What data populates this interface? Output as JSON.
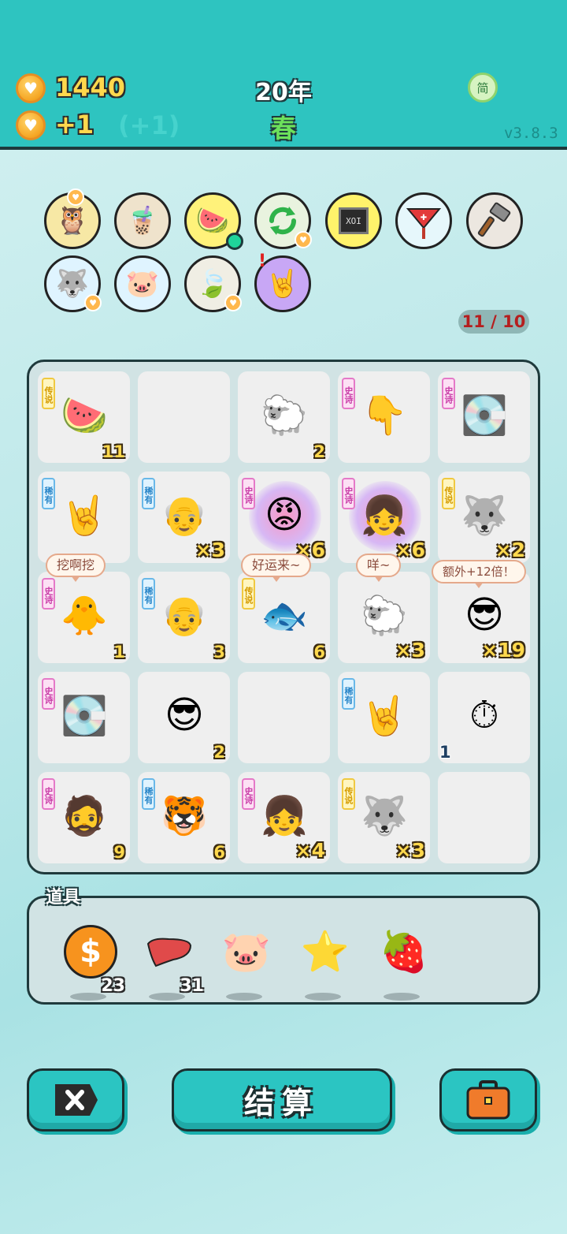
{
  "header": {
    "coins": "1440",
    "income": "+1",
    "bonus": "(+1)",
    "year": "20年",
    "season": "春",
    "lang_button": "简",
    "version": "v3.8.3"
  },
  "toolbar_icons": [
    "owls-icon",
    "bubble-tea-icon",
    "fruit-basket-icon",
    "refresh-icon",
    "chip-icon",
    "heart-potion-icon",
    "hammer-icon",
    "husky-icon",
    "piggy-bank-icon",
    "leaf-icon",
    "rock-hand-icon"
  ],
  "capacity": "11 / 10",
  "board": {
    "cells": [
      {
        "tag": "传说",
        "rarity": "legend",
        "icon": "watermelon-icon",
        "count": "11"
      },
      {
        "tag": "",
        "rarity": "",
        "icon": "",
        "count": ""
      },
      {
        "tag": "",
        "rarity": "",
        "icon": "sheep-icon",
        "count": "2"
      },
      {
        "tag": "史诗",
        "rarity": "epic",
        "icon": "pointing-hand-icon",
        "count": ""
      },
      {
        "tag": "史诗",
        "rarity": "epic",
        "icon": "graphics-card-icon",
        "count": ""
      },
      {
        "tag": "稀有",
        "rarity": "rare",
        "icon": "rock-hand-icon",
        "count": ""
      },
      {
        "tag": "稀有",
        "rarity": "rare",
        "icon": "bald-man-icon",
        "count": "×3"
      },
      {
        "tag": "史诗",
        "rarity": "epic",
        "icon": "red-face-icon",
        "count": "×6"
      },
      {
        "tag": "史诗",
        "rarity": "epic",
        "icon": "girl-icon",
        "count": "×6"
      },
      {
        "tag": "传说",
        "rarity": "legend",
        "icon": "husky-king-icon",
        "count": "×2"
      },
      {
        "tag": "史诗",
        "rarity": "epic",
        "icon": "chick-face-icon",
        "count": "1"
      },
      {
        "tag": "稀有",
        "rarity": "rare",
        "icon": "bald-man-icon",
        "count": "3"
      },
      {
        "tag": "传说",
        "rarity": "legend",
        "icon": "koi-fish-icon",
        "count": "6"
      },
      {
        "tag": "",
        "rarity": "",
        "icon": "sheep-icon",
        "count": "×3"
      },
      {
        "tag": "",
        "rarity": "",
        "icon": "sunglasses-grandpa-icon",
        "count": "×19"
      },
      {
        "tag": "史诗",
        "rarity": "epic",
        "icon": "graphics-card-icon",
        "count": ""
      },
      {
        "tag": "",
        "rarity": "",
        "icon": "sunglasses-grandpa-icon",
        "count": "2"
      },
      {
        "tag": "",
        "rarity": "",
        "icon": "",
        "count": ""
      },
      {
        "tag": "稀有",
        "rarity": "rare",
        "icon": "rock-hand-icon",
        "count": ""
      },
      {
        "tag": "",
        "rarity": "",
        "icon": "stopwatch-icon",
        "count": "1"
      },
      {
        "tag": "史诗",
        "rarity": "epic",
        "icon": "green-hat-man-icon",
        "count": "9"
      },
      {
        "tag": "稀有",
        "rarity": "rare",
        "icon": "tiger-icon",
        "count": "6"
      },
      {
        "tag": "史诗",
        "rarity": "epic",
        "icon": "girl-icon",
        "count": "×4"
      },
      {
        "tag": "传说",
        "rarity": "legend",
        "icon": "husky-king-icon",
        "count": "×3"
      },
      {
        "tag": "",
        "rarity": "",
        "icon": "",
        "count": ""
      }
    ],
    "bubbles": [
      "挖啊挖",
      "好运来~",
      "咩~",
      "额外+12倍！"
    ]
  },
  "props": {
    "label": "道具",
    "items": [
      {
        "icon": "dollar-coin-icon",
        "count": "23"
      },
      {
        "icon": "liver-icon",
        "count": "31"
      },
      {
        "icon": "piggy-bank-icon",
        "count": ""
      },
      {
        "icon": "star-icon",
        "count": ""
      },
      {
        "icon": "strawberry-icon",
        "count": ""
      }
    ]
  },
  "buttons": {
    "settle": "结算"
  },
  "colors": {
    "topbar": "#2ec4c0",
    "legend": "#f0c940",
    "epic": "#e579c8",
    "rare": "#69b8e8"
  }
}
